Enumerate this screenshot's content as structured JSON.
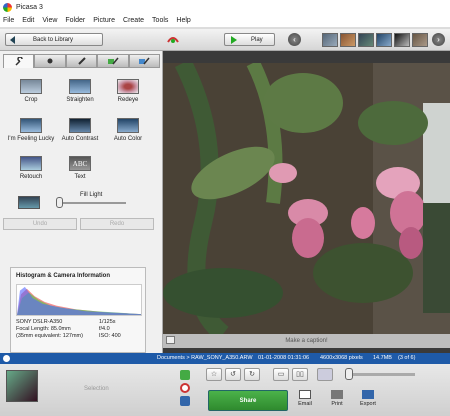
{
  "window": {
    "title": "Picasa 3"
  },
  "menu": [
    "File",
    "Edit",
    "View",
    "Folder",
    "Picture",
    "Create",
    "Tools",
    "Help"
  ],
  "toolbar": {
    "back_label": "Back to Library",
    "play_label": "Play"
  },
  "tools": [
    {
      "label": "Crop"
    },
    {
      "label": "Straighten"
    },
    {
      "label": "Redeye"
    },
    {
      "label": "I'm Feeling Lucky"
    },
    {
      "label": "Auto Contrast"
    },
    {
      "label": "Auto Color"
    },
    {
      "label": "Retouch"
    },
    {
      "label": "Text"
    }
  ],
  "fill_light": {
    "label": "Fill Light",
    "level": 0
  },
  "buttons": {
    "undo": "Undo",
    "redo": "Redo"
  },
  "histogram": {
    "title": "Histogram & Camera Information",
    "camera": "SONY   DSLR-A350",
    "focal": "Focal Length: 85.0mm",
    "equiv": "(35mm equivalent: 127mm)",
    "shutter": "1/125s",
    "aperture": "f/4.0",
    "iso": "ISO: 400"
  },
  "caption": {
    "placeholder": "Make a caption!"
  },
  "status": {
    "path": "Documents > RAW_SONY_A350.ARW",
    "date": "01-01-2008 01:31:06",
    "dimensions": "4600x3068 pixels",
    "size": "14.7MB",
    "position": "(3 of 6)"
  },
  "tray": {
    "label": "Selection"
  },
  "actions": {
    "share": "Share",
    "email": "Email",
    "print": "Print",
    "export": "Export"
  }
}
